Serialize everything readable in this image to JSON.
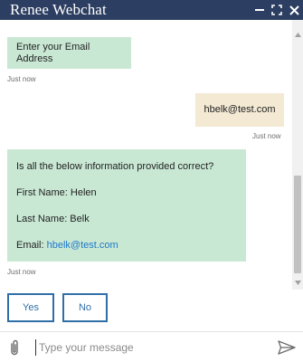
{
  "window": {
    "title": "Renee Webchat",
    "controls": [
      {
        "icon": "minimize-icon"
      },
      {
        "icon": "maximize-icon"
      },
      {
        "icon": "close-icon"
      }
    ]
  },
  "messages": [
    {
      "from": "bot",
      "text": "Enter your Email Address",
      "time": "Just now"
    },
    {
      "from": "user",
      "text": "hbelk@test.com",
      "time": "Just now"
    },
    {
      "from": "bot",
      "lines": [
        "Is all the below information provided correct?",
        "First Name: Helen",
        "Last Name: Belk"
      ],
      "email_label": "Email: ",
      "email_link": "hbelk@test.com",
      "time": "Just now"
    }
  ],
  "quick_replies": [
    "Yes",
    "No"
  ],
  "composer": {
    "placeholder": "Type your message",
    "attach_icon": "paperclip-icon",
    "send_icon": "send-icon"
  },
  "colors": {
    "titlebar": "#2c3e61",
    "bot_bubble": "#c9e8d4",
    "user_bubble": "#f4ead4",
    "accent": "#2f6fa8",
    "link": "#1f78c8"
  }
}
